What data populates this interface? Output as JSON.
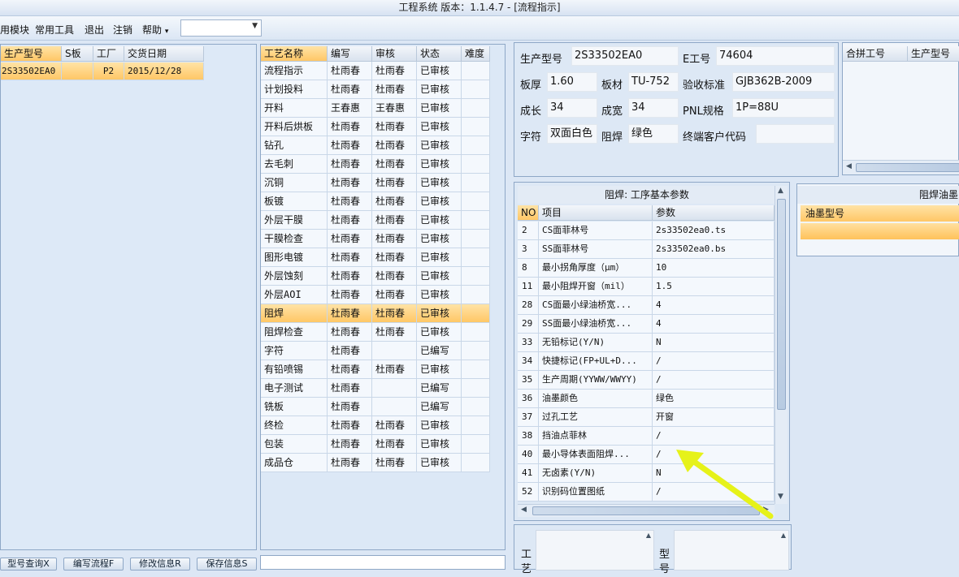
{
  "window": {
    "title": "工程系统   版本：1.1.4.7 - [流程指示]"
  },
  "menu": {
    "items": [
      "用模块",
      "常用工具",
      "退出",
      "注销",
      "帮助"
    ],
    "help_arrow": "▾",
    "dropdown_value": ""
  },
  "left": {
    "headers": [
      "生产型号",
      "S板",
      "工厂",
      "交货日期"
    ],
    "rows": [
      [
        "2S33502EA0",
        "",
        "P2",
        "2015/12/28"
      ]
    ]
  },
  "process": {
    "headers": [
      "工艺名称",
      "编写",
      "审核",
      "状态",
      "难度"
    ],
    "rows": [
      [
        "流程指示",
        "杜雨春",
        "杜雨春",
        "已审核",
        ""
      ],
      [
        "计划投料",
        "杜雨春",
        "杜雨春",
        "已审核",
        ""
      ],
      [
        "开料",
        "王春惠",
        "王春惠",
        "已审核",
        ""
      ],
      [
        "开料后烘板",
        "杜雨春",
        "杜雨春",
        "已审核",
        ""
      ],
      [
        "钻孔",
        "杜雨春",
        "杜雨春",
        "已审核",
        ""
      ],
      [
        "去毛刺",
        "杜雨春",
        "杜雨春",
        "已审核",
        ""
      ],
      [
        "沉铜",
        "杜雨春",
        "杜雨春",
        "已审核",
        ""
      ],
      [
        "板镀",
        "杜雨春",
        "杜雨春",
        "已审核",
        ""
      ],
      [
        "外层干膜",
        "杜雨春",
        "杜雨春",
        "已审核",
        ""
      ],
      [
        "干膜检查",
        "杜雨春",
        "杜雨春",
        "已审核",
        ""
      ],
      [
        "图形电镀",
        "杜雨春",
        "杜雨春",
        "已审核",
        ""
      ],
      [
        "外层蚀刻",
        "杜雨春",
        "杜雨春",
        "已审核",
        ""
      ],
      [
        "外层AOI",
        "杜雨春",
        "杜雨春",
        "已审核",
        ""
      ],
      [
        "阻焊",
        "杜雨春",
        "杜雨春",
        "已审核",
        ""
      ],
      [
        "阻焊检查",
        "杜雨春",
        "杜雨春",
        "已审核",
        ""
      ],
      [
        "字符",
        "杜雨春",
        "",
        "已编写",
        ""
      ],
      [
        "有铅喷锡",
        "杜雨春",
        "杜雨春",
        "已审核",
        ""
      ],
      [
        "电子测试",
        "杜雨春",
        "",
        "已编写",
        ""
      ],
      [
        "铣板",
        "杜雨春",
        "",
        "已编写",
        ""
      ],
      [
        "终检",
        "杜雨春",
        "杜雨春",
        "已审核",
        ""
      ],
      [
        "包装",
        "杜雨春",
        "杜雨春",
        "已审核",
        ""
      ],
      [
        "成品仓",
        "杜雨春",
        "杜雨春",
        "已审核",
        ""
      ]
    ],
    "selected_index": 13
  },
  "info": {
    "model_label": "生产型号",
    "model_value": "2S33502EA0",
    "eno_label": "E工号",
    "eno_value": "74604",
    "thick_label": "板厚",
    "thick_value": "1.60",
    "material_label": "板材",
    "material_value": "TU-752",
    "standard_label": "验收标准",
    "standard_value": "GJB362B-2009",
    "length_label": "成长",
    "length_value": "34",
    "width_label": "成宽",
    "width_value": "34",
    "pnl_label": "PNL规格",
    "pnl_value": "1P=88U",
    "char_label": "字符",
    "char_value": "双面白色",
    "mask_label": "阻焊",
    "mask_value": "绿色",
    "customer_label": "终端客户代码",
    "customer_value": ""
  },
  "combine": {
    "headers": [
      "合拼工号",
      "生产型号"
    ]
  },
  "params": {
    "title": "阻焊: 工序基本参数",
    "headers": [
      "NO",
      "项目",
      "参数"
    ],
    "rows": [
      [
        "2",
        "CS面菲林号",
        "2s33502ea0.ts"
      ],
      [
        "3",
        "SS面菲林号",
        "2s33502ea0.bs"
      ],
      [
        "8",
        "最小拐角厚度（μm）",
        "10"
      ],
      [
        "11",
        "最小阻焊开窗（mil）",
        "1.5"
      ],
      [
        "28",
        "CS面最小绿油桥宽...",
        "4"
      ],
      [
        "29",
        "SS面最小绿油桥宽...",
        "4"
      ],
      [
        "33",
        "无铅标记(Y/N)",
        "N"
      ],
      [
        "34",
        "快捷标记(FP+UL+D...",
        "/"
      ],
      [
        "35",
        "生产周期(YYWW/WWYY)",
        "/"
      ],
      [
        "36",
        "油墨颜色",
        "绿色"
      ],
      [
        "37",
        "过孔工艺",
        "开窗"
      ],
      [
        "38",
        "挡油点菲林",
        "/"
      ],
      [
        "40",
        "最小导体表面阻焊...",
        "/"
      ],
      [
        "41",
        "无卤素(Y/N)",
        "N"
      ],
      [
        "52",
        "识别码位置图纸",
        "/"
      ]
    ]
  },
  "ink": {
    "title": "阻焊油墨",
    "header": "油墨型号"
  },
  "bottom": {
    "label1": "工艺",
    "label2": "型号"
  },
  "buttons": [
    "型号查询X",
    "编写流程F",
    "修改信息R",
    "保存信息S"
  ]
}
